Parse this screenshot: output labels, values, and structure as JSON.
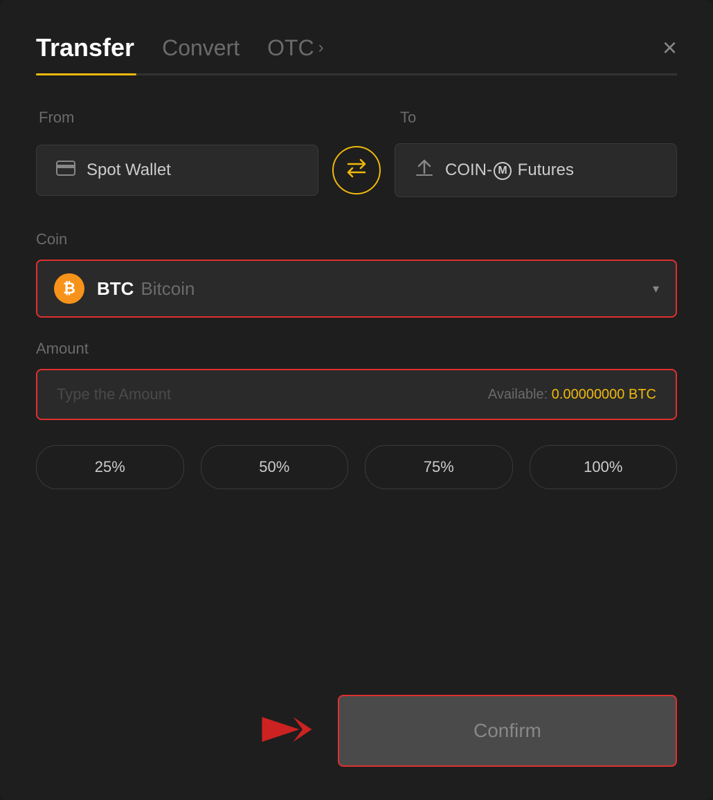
{
  "header": {
    "tab_transfer": "Transfer",
    "tab_convert": "Convert",
    "tab_otc": "OTC",
    "close_label": "×"
  },
  "from_section": {
    "label": "From",
    "wallet_name": "Spot Wallet",
    "wallet_icon": "💳"
  },
  "to_section": {
    "label": "To",
    "wallet_name": "COIN-M Futures",
    "wallet_icon": "↑"
  },
  "swap": {
    "icon": "⇄"
  },
  "coin_section": {
    "label": "Coin",
    "ticker": "BTC",
    "name": "Bitcoin"
  },
  "amount_section": {
    "label": "Amount",
    "placeholder": "Type the Amount",
    "available_label": "Available:",
    "available_value": "0.00000000 BTC"
  },
  "percentage_buttons": [
    "25%",
    "50%",
    "75%",
    "100%"
  ],
  "confirm_button": {
    "label": "Confirm"
  }
}
